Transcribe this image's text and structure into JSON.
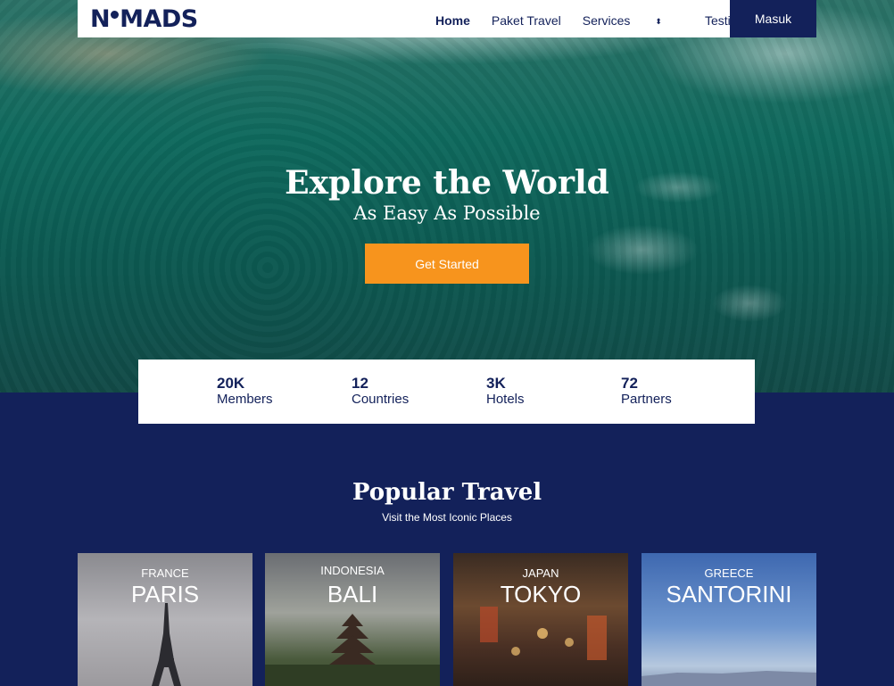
{
  "brand": {
    "logo": "NMADS",
    "logo_left": "N",
    "logo_right": "MADS"
  },
  "nav": {
    "items": [
      {
        "label": "Home"
      },
      {
        "label": "Paket Travel"
      },
      {
        "label": "Services"
      },
      {
        "label": "Testimonials"
      }
    ],
    "login_label": "Masuk"
  },
  "hero": {
    "title": "Explore the World",
    "subtitle": "As Easy As Possible",
    "cta_label": "Get Started"
  },
  "stats": [
    {
      "value": "20K",
      "label": "Members"
    },
    {
      "value": "12",
      "label": "Countries"
    },
    {
      "value": "3K",
      "label": "Hotels"
    },
    {
      "value": "72",
      "label": "Partners"
    }
  ],
  "popular": {
    "title": "Popular Travel",
    "subtitle": "Visit the Most Iconic Places",
    "cards": [
      {
        "country": "FRANCE",
        "city": "PARIS"
      },
      {
        "country": "INDONESIA",
        "city": "BALI"
      },
      {
        "country": "JAPAN",
        "city": "TOKYO"
      },
      {
        "country": "GREECE",
        "city": "SANTORINI"
      }
    ]
  },
  "colors": {
    "navy": "#13215a",
    "accent": "#f7941d",
    "white": "#ffffff"
  }
}
